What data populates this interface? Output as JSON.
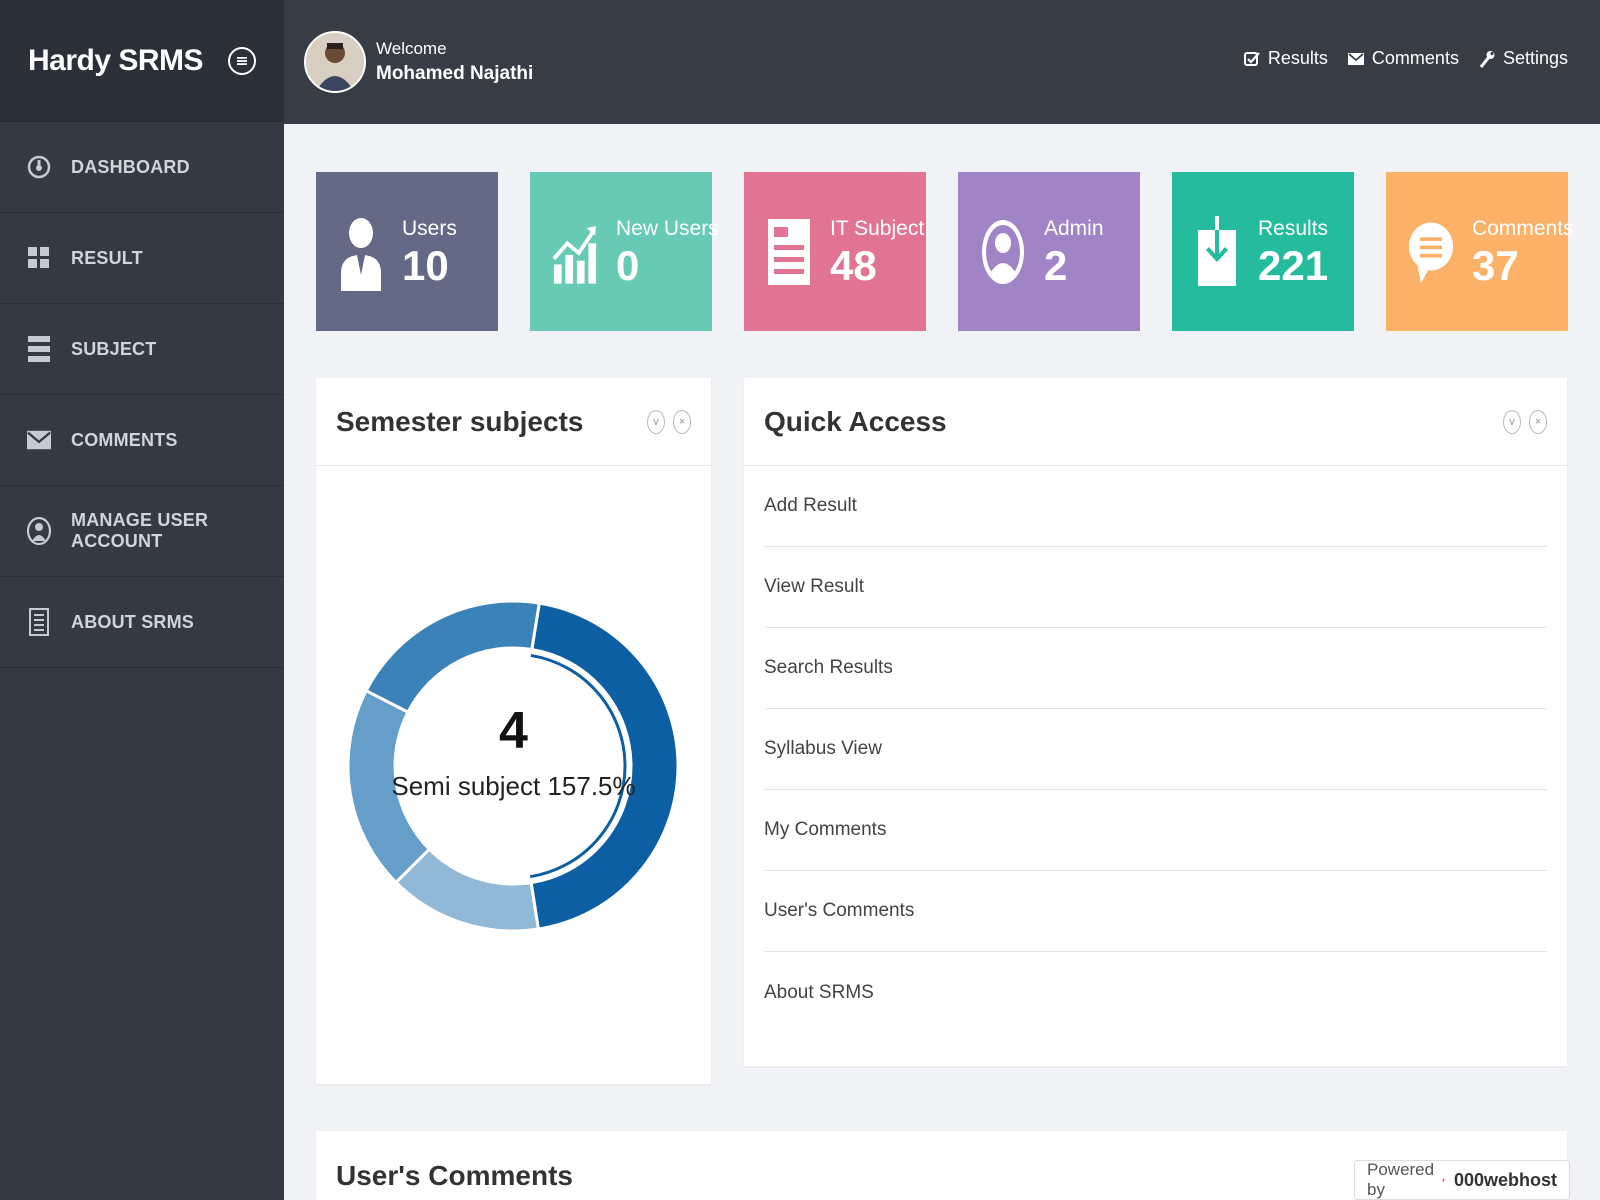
{
  "sidebar": {
    "brand": "Hardy SRMS",
    "items": [
      {
        "label": "DASHBOARD",
        "icon": "dashboard-icon"
      },
      {
        "label": "RESULT",
        "icon": "grid-icon"
      },
      {
        "label": "SUBJECT",
        "icon": "list-icon"
      },
      {
        "label": "COMMENTS",
        "icon": "envelope-icon"
      },
      {
        "label": "MANAGE USER ACCOUNT",
        "icon": "user-circle-icon"
      },
      {
        "label": "ABOUT SRMS",
        "icon": "document-icon"
      }
    ]
  },
  "header": {
    "welcome": "Welcome",
    "user_name": "Mohamed Najathi",
    "links": [
      {
        "label": "Results",
        "icon": "check-icon"
      },
      {
        "label": "Comments",
        "icon": "envelope-icon"
      },
      {
        "label": "Settings",
        "icon": "wrench-icon"
      }
    ]
  },
  "cards": [
    {
      "label": "Users",
      "value": "10",
      "color": "#646a85",
      "icon": "user-icon"
    },
    {
      "label": "New Users",
      "value": "0",
      "color": "#67cab5",
      "icon": "chart-up-icon"
    },
    {
      "label": "IT Subject",
      "value": "48",
      "color": "#e27493",
      "icon": "document-icon"
    },
    {
      "label": "Admin",
      "value": "2",
      "color": "#a184c6",
      "icon": "admin-icon"
    },
    {
      "label": "Results",
      "value": "221",
      "color": "#24bc9c",
      "icon": "download-icon"
    },
    {
      "label": "Comments",
      "value": "37",
      "color": "#fbb168",
      "icon": "speech-bubble-icon"
    }
  ],
  "semester": {
    "title": "Semester subjects",
    "center_value": "4",
    "center_label": "Semi subject 157.5%"
  },
  "chart_data": {
    "type": "pie",
    "values": [
      45,
      15,
      20,
      20
    ],
    "colors": [
      "#0d5fa3",
      "#92b8d8",
      "#649ec9",
      "#3a82b8"
    ]
  },
  "quick_access": {
    "title": "Quick Access",
    "items": [
      "Add Result",
      "View Result",
      "Search Results",
      "Syllabus View",
      "My Comments",
      "User's Comments",
      "About SRMS"
    ]
  },
  "user_comments": {
    "title": "User's Comments"
  },
  "footer_badge": {
    "prefix": "Powered by",
    "brand": "000webhost"
  }
}
